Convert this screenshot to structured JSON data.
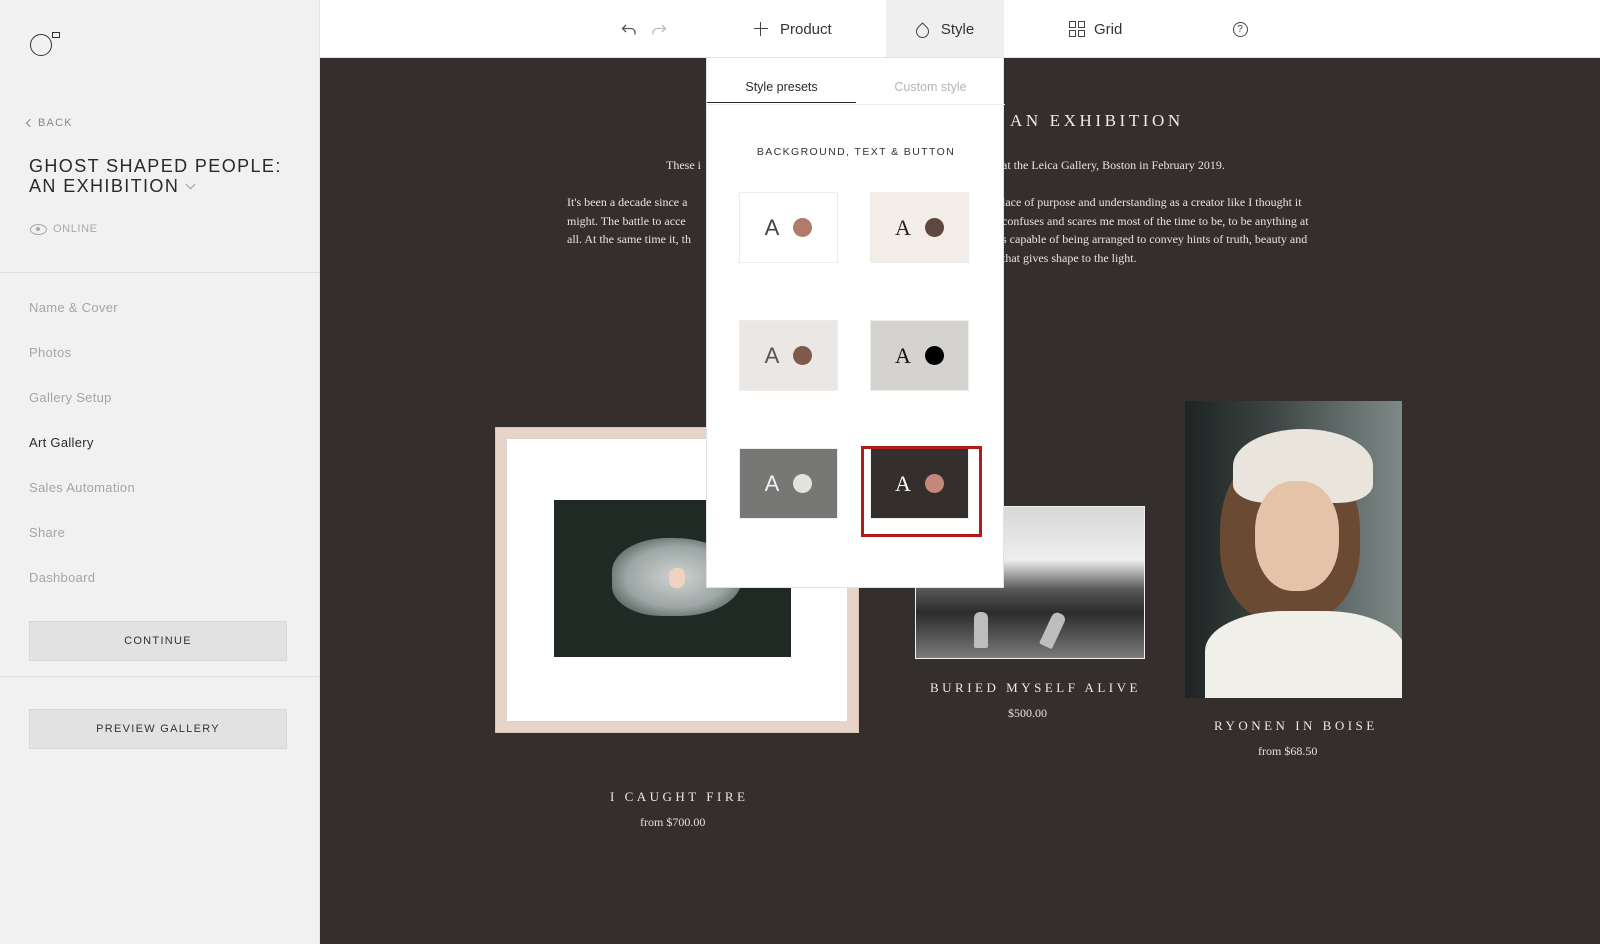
{
  "sidebar": {
    "back_label": "BACK",
    "gallery_title": "GHOST SHAPED PEOPLE: AN EXHIBITION",
    "status": "ONLINE",
    "nav": [
      {
        "label": "Name & Cover"
      },
      {
        "label": "Photos"
      },
      {
        "label": "Gallery Setup"
      },
      {
        "label": "Art Gallery",
        "active": true
      },
      {
        "label": "Sales Automation"
      },
      {
        "label": "Share"
      },
      {
        "label": "Dashboard"
      }
    ],
    "continue_label": "CONTINUE",
    "preview_label": "PREVIEW GALLERY"
  },
  "toolbar": {
    "undo_icon": "undo-icon",
    "redo_icon": "redo-icon",
    "product_label": "Product",
    "style_label": "Style",
    "grid_label": "Grid",
    "help_glyph": "?"
  },
  "style_popover": {
    "tabs": [
      {
        "label": "Style presets",
        "selected": true
      },
      {
        "label": "Custom style",
        "selected": false
      }
    ],
    "section_title": "BACKGROUND, TEXT & BUTTON",
    "presets": [
      {
        "letter": "A",
        "bg": "#ffffff",
        "text": "#444444",
        "button": "#b07b6a",
        "serif": false,
        "selected": false
      },
      {
        "letter": "A",
        "bg": "#f3ede7",
        "text": "#2b2522",
        "button": "#5e4740",
        "serif": true,
        "selected": false
      },
      {
        "letter": "A",
        "bg": "#eae7e4",
        "text": "#555555",
        "button": "#7e5a4c",
        "serif": false,
        "selected": false
      },
      {
        "letter": "A",
        "bg": "#d5d3cf",
        "text": "#111111",
        "button": "#000000",
        "serif": true,
        "selected": false
      },
      {
        "letter": "A",
        "bg": "#777775",
        "text": "#f2f2f2",
        "button": "#e3e3dc",
        "serif": false,
        "selected": false
      },
      {
        "letter": "A",
        "bg": "#342f2c",
        "text": "#ffffff",
        "button": "#c4887a",
        "serif": true,
        "selected": true
      }
    ]
  },
  "canvas": {
    "heading_visible": "AN EXHIBITION",
    "intro_left": "These i",
    "intro_right": "at the Leica Gallery, Boston in February 2019.",
    "body_left": [
      "It's been a decade since a",
      "might. The battle to acce",
      "all. At the same time it, th"
    ],
    "body_right": [
      "lace of purpose and understanding as a creator like I thought it",
      "confuses and scares me most of the time to be, to be anything at",
      "s capable of being arranged to convey hints of truth, beauty and",
      "that gives shape to the light."
    ],
    "products": [
      {
        "title": "I CAUGHT FIRE",
        "price": "from $700.00"
      },
      {
        "title": "BURIED MYSELF ALIVE",
        "price": "$500.00"
      },
      {
        "title": "RYONEN IN BOISE",
        "price": "from $68.50"
      }
    ]
  }
}
